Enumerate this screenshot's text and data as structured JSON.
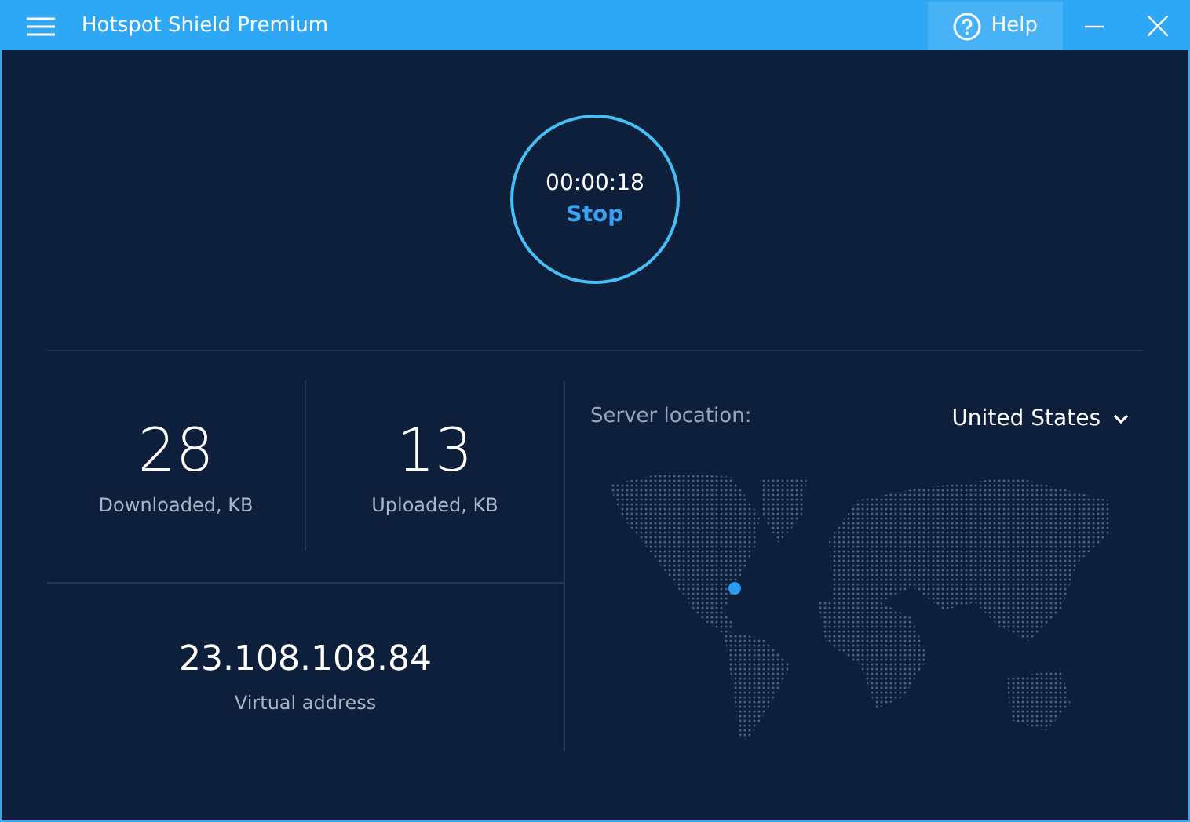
{
  "window": {
    "title": "Hotspot Shield Premium",
    "help": "Help"
  },
  "connection": {
    "timer": "00:00:18",
    "action": "Stop"
  },
  "stats": [
    {
      "value": "28",
      "label": "Downloaded, KB"
    },
    {
      "value": "13",
      "label": "Uploaded, KB"
    }
  ],
  "virtual_address": {
    "value": "23.108.108.84",
    "label": "Virtual address"
  },
  "server": {
    "label": "Server location:",
    "country": "United States"
  }
}
